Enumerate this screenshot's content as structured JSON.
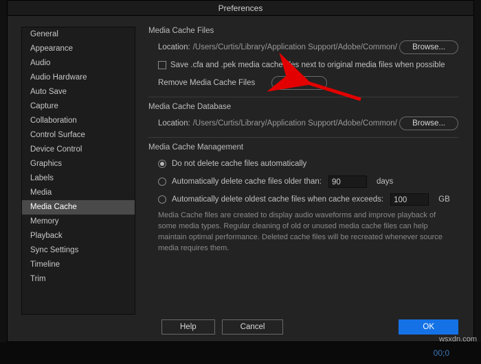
{
  "title": "Preferences",
  "sidebar": {
    "items": [
      {
        "label": "General"
      },
      {
        "label": "Appearance"
      },
      {
        "label": "Audio"
      },
      {
        "label": "Audio Hardware"
      },
      {
        "label": "Auto Save"
      },
      {
        "label": "Capture"
      },
      {
        "label": "Collaboration"
      },
      {
        "label": "Control Surface"
      },
      {
        "label": "Device Control"
      },
      {
        "label": "Graphics"
      },
      {
        "label": "Labels"
      },
      {
        "label": "Media"
      },
      {
        "label": "Media Cache",
        "selected": true
      },
      {
        "label": "Memory"
      },
      {
        "label": "Playback"
      },
      {
        "label": "Sync Settings"
      },
      {
        "label": "Timeline"
      },
      {
        "label": "Trim"
      }
    ]
  },
  "sections": {
    "cacheFiles": {
      "title": "Media Cache Files",
      "locationLabel": "Location:",
      "locationPath": "/Users/Curtis/Library/Application Support/Adobe/Common/",
      "browseLabel": "Browse...",
      "saveCheckbox": "Save .cfa and .pek media cache files next to original media files when possible",
      "removeLabel": "Remove Media Cache Files",
      "deleteLabel": "Delete..."
    },
    "cacheDb": {
      "title": "Media Cache Database",
      "locationLabel": "Location:",
      "locationPath": "/Users/Curtis/Library/Application Support/Adobe/Common/",
      "browseLabel": "Browse..."
    },
    "management": {
      "title": "Media Cache Management",
      "opt1": "Do not delete cache files automatically",
      "opt2": "Automatically delete cache files older than:",
      "opt2Value": "90",
      "opt2Unit": "days",
      "opt3": "Automatically delete oldest cache files when cache exceeds:",
      "opt3Value": "100",
      "opt3Unit": "GB",
      "desc": "Media Cache files are created to display audio waveforms and improve playback of some media types.  Regular cleaning of old or unused media cache files can help maintain optimal performance. Deleted cache files will be recreated whenever source media requires them."
    }
  },
  "footer": {
    "help": "Help",
    "cancel": "Cancel",
    "ok": "OK"
  },
  "timecode": "00;0",
  "watermark": "wsxdn.com"
}
